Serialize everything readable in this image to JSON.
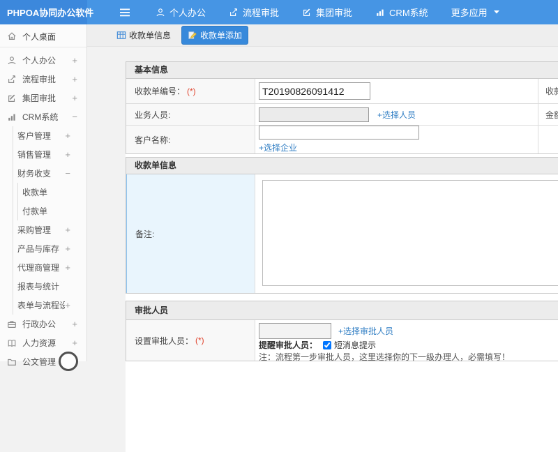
{
  "app_title": "PHPOA协同办公软件",
  "topnav": {
    "items": [
      {
        "id": "personal-office",
        "label": "个人办公",
        "icon": "user-icon"
      },
      {
        "id": "workflow-approval",
        "label": "流程审批",
        "icon": "workflow-icon"
      },
      {
        "id": "group-approval",
        "label": "集团审批",
        "icon": "edit-icon"
      },
      {
        "id": "crm-system",
        "label": "CRM系统",
        "icon": "chart-icon"
      },
      {
        "id": "more-apps",
        "label": "更多应用",
        "icon": "",
        "caret": true
      }
    ]
  },
  "sidebar": {
    "items": [
      {
        "id": "personal-desktop",
        "label": "个人桌面",
        "icon": "home-icon",
        "expand": "",
        "level": 0,
        "first": true
      },
      {
        "id": "personal-office",
        "label": "个人办公",
        "icon": "user-icon",
        "expand": "+",
        "level": 0
      },
      {
        "id": "workflow-approval",
        "label": "流程审批",
        "icon": "workflow-icon",
        "expand": "+",
        "level": 0
      },
      {
        "id": "group-approval",
        "label": "集团审批",
        "icon": "edit-icon",
        "expand": "+",
        "level": 0
      },
      {
        "id": "crm-system",
        "label": "CRM系统",
        "icon": "chart-icon",
        "expand": "−",
        "level": 0
      },
      {
        "id": "customer-mgmt",
        "label": "客户管理",
        "icon": "",
        "expand": "+",
        "level": 1
      },
      {
        "id": "sales-mgmt",
        "label": "销售管理",
        "icon": "",
        "expand": "+",
        "level": 1
      },
      {
        "id": "finance",
        "label": "财务收支",
        "icon": "",
        "expand": "−",
        "level": 1
      },
      {
        "id": "receipt",
        "label": "收款单",
        "icon": "",
        "expand": "",
        "level": 2
      },
      {
        "id": "payment",
        "label": "付款单",
        "icon": "",
        "expand": "",
        "level": 2
      },
      {
        "id": "purchase-mgmt",
        "label": "采购管理",
        "icon": "",
        "expand": "+",
        "level": 1
      },
      {
        "id": "product-inventory",
        "label": "产品与库存",
        "icon": "",
        "expand": "+",
        "level": 1
      },
      {
        "id": "agent-mgmt",
        "label": "代理商管理",
        "icon": "",
        "expand": "+",
        "level": 1
      },
      {
        "id": "reports-stats",
        "label": "报表与统计",
        "icon": "",
        "expand": "",
        "level": 1
      },
      {
        "id": "form-flow-settings",
        "label": "表单与流程设置",
        "icon": "",
        "expand": "+",
        "level": 1
      },
      {
        "id": "admin-office",
        "label": "行政办公",
        "icon": "briefcase-icon",
        "expand": "+",
        "level": 0
      },
      {
        "id": "human-resources",
        "label": "人力资源",
        "icon": "book-icon",
        "expand": "+",
        "level": 0
      },
      {
        "id": "document-mgmt",
        "label": "公文管理",
        "icon": "folder-icon",
        "expand": "+",
        "level": 0
      }
    ]
  },
  "tabs": [
    {
      "id": "receipt-info",
      "label": "收款单信息",
      "icon": "grid-icon",
      "active": false
    },
    {
      "id": "receipt-add",
      "label": "收款单添加",
      "icon": "edit-doc-icon",
      "active": true
    }
  ],
  "form": {
    "sections": {
      "basic": {
        "title": "基本信息",
        "receipt_no": {
          "label": "收款单编号：",
          "required": "(*)",
          "value": "T20190826091412"
        },
        "salesperson": {
          "label": "业务人员:",
          "value": "",
          "link": "+选择人员"
        },
        "customer": {
          "label": "客户名称:",
          "value": "",
          "link": "+选择企业"
        },
        "right_col": {
          "date_label": "收款单日期:",
          "amount_label": "金额:"
        }
      },
      "receipt_info": {
        "title": "收款单信息",
        "remark": {
          "label": "备注:",
          "value": ""
        }
      },
      "approver": {
        "title": "审批人员",
        "set_approver": {
          "label": "设置审批人员：",
          "required": "(*)",
          "value": "",
          "link": "+选择审批人员"
        },
        "remind": {
          "label": "提醒审批人员：",
          "checkbox_label": "短消息提示",
          "checked": true
        },
        "note": "注：流程第一步审批人员，这里选择你的下一级办理人，必需填写！"
      }
    }
  },
  "colors": {
    "topbar": "#4695e4",
    "logo_bg": "#3c88dc",
    "active_tab": "#3789db",
    "link": "#2f7dc3",
    "required": "#e0452f",
    "remark_cell_bg": "#e9f5fd",
    "remark_cell_border": "#8fc3ee"
  }
}
